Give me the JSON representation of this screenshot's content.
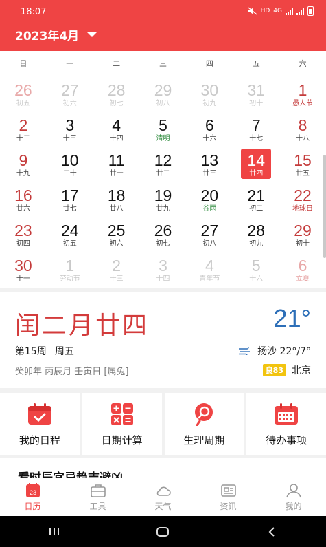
{
  "status": {
    "time": "18:07",
    "hd": "HD",
    "net": "4G"
  },
  "header": {
    "month_title": "2023年4月"
  },
  "weekdays": [
    "日",
    "一",
    "二",
    "三",
    "四",
    "五",
    "六"
  ],
  "weeks": [
    [
      {
        "d": "26",
        "s": "初五",
        "o": true
      },
      {
        "d": "27",
        "s": "初六",
        "o": true
      },
      {
        "d": "28",
        "s": "初七",
        "o": true
      },
      {
        "d": "29",
        "s": "初八",
        "o": true
      },
      {
        "d": "30",
        "s": "初九",
        "o": true
      },
      {
        "d": "31",
        "s": "初十",
        "o": true
      },
      {
        "d": "1",
        "s": "愚人节",
        "f": "red"
      }
    ],
    [
      {
        "d": "2",
        "s": "十二"
      },
      {
        "d": "3",
        "s": "十三"
      },
      {
        "d": "4",
        "s": "十四"
      },
      {
        "d": "5",
        "s": "清明",
        "f": "green"
      },
      {
        "d": "6",
        "s": "十六"
      },
      {
        "d": "7",
        "s": "十七"
      },
      {
        "d": "8",
        "s": "十八"
      }
    ],
    [
      {
        "d": "9",
        "s": "十九"
      },
      {
        "d": "10",
        "s": "二十"
      },
      {
        "d": "11",
        "s": "廿一"
      },
      {
        "d": "12",
        "s": "廿二"
      },
      {
        "d": "13",
        "s": "廿三"
      },
      {
        "d": "14",
        "s": "廿四",
        "t": true
      },
      {
        "d": "15",
        "s": "廿五"
      }
    ],
    [
      {
        "d": "16",
        "s": "廿六"
      },
      {
        "d": "17",
        "s": "廿七"
      },
      {
        "d": "18",
        "s": "廿八"
      },
      {
        "d": "19",
        "s": "廿九"
      },
      {
        "d": "20",
        "s": "谷雨",
        "f": "green"
      },
      {
        "d": "21",
        "s": "初二"
      },
      {
        "d": "22",
        "s": "地球日",
        "f": "red"
      }
    ],
    [
      {
        "d": "23",
        "s": "初四"
      },
      {
        "d": "24",
        "s": "初五"
      },
      {
        "d": "25",
        "s": "初六"
      },
      {
        "d": "26",
        "s": "初七"
      },
      {
        "d": "27",
        "s": "初八"
      },
      {
        "d": "28",
        "s": "初九"
      },
      {
        "d": "29",
        "s": "初十"
      }
    ],
    [
      {
        "d": "30",
        "s": "十一"
      },
      {
        "d": "1",
        "s": "劳动节",
        "o": true
      },
      {
        "d": "2",
        "s": "十三",
        "o": true
      },
      {
        "d": "3",
        "s": "十四",
        "o": true
      },
      {
        "d": "4",
        "s": "青年节",
        "o": true
      },
      {
        "d": "5",
        "s": "十六",
        "o": true
      },
      {
        "d": "6",
        "s": "立夏",
        "o": true,
        "f": "fade"
      }
    ]
  ],
  "info": {
    "lunar_date": "闰二月廿四",
    "temperature": "21°",
    "week_no": "第15周",
    "weekday": "周五",
    "ganzhi": "癸卯年 丙辰月 壬寅日 [属兔]",
    "weather": "扬沙 22°/7°",
    "aq_badge": "良83",
    "city": "北京"
  },
  "tools": [
    {
      "label": "我的日程",
      "icon": "schedule-icon"
    },
    {
      "label": "日期计算",
      "icon": "calculator-icon"
    },
    {
      "label": "生理周期",
      "icon": "cycle-icon"
    },
    {
      "label": "待办事项",
      "icon": "todo-icon"
    }
  ],
  "article": {
    "title": "看时辰宜忌趋吉避凶"
  },
  "tabs": [
    {
      "label": "日历",
      "icon": "calendar-tab-icon",
      "badge": "23",
      "active": true
    },
    {
      "label": "工具",
      "icon": "toolbox-icon"
    },
    {
      "label": "天气",
      "icon": "weather-icon"
    },
    {
      "label": "资讯",
      "icon": "news-icon"
    },
    {
      "label": "我的",
      "icon": "profile-icon"
    }
  ],
  "colors": {
    "accent": "#ef4444",
    "weekend": "#c43a3a",
    "festival_green": "#2e8b3d",
    "temp_blue": "#2d6fb8",
    "aq_yellow": "#f2c40f"
  }
}
